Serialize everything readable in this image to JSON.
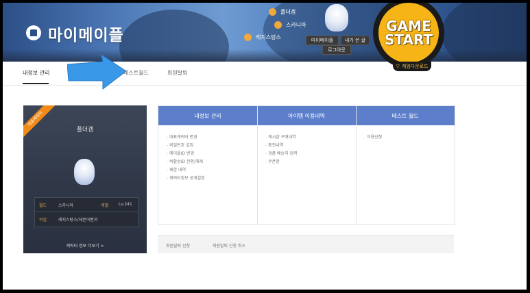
{
  "header": {
    "title": "마이메이플",
    "character_name": "플더겜",
    "world": "스카니아",
    "job": "레지스탕스",
    "buttons": [
      "마이메이플",
      "내가 쓴 글",
      "로그아웃"
    ],
    "game_start": "GAME START",
    "download": "게임다운로드"
  },
  "tabs": [
    {
      "label": "내정보 관리",
      "active": true
    },
    {
      "label": "테스트월드",
      "active": false
    },
    {
      "label": "회원탈퇴",
      "active": false
    }
  ],
  "character_card": {
    "ribbon": "대표캐릭터",
    "name": "플더겜",
    "world_label": "월드",
    "world_value": "스카니아",
    "level_label": "레벨",
    "level_value": "Lv.241",
    "job_label": "직업",
    "job_value": "레지스탕스/데몬어벤져",
    "more_link": "캐릭터 정보 더보기 >"
  },
  "menu": {
    "columns": [
      {
        "header": "내정보 관리",
        "items": [
          "대표캐릭터 변경",
          "비밀번호 설정",
          "메이플ID 변경",
          "비활성ID 전환/해제",
          "제한 내역",
          "캐릭터정보 공개설정"
        ]
      },
      {
        "header": "아이템 이용내역",
        "items": [
          "캐시샵 구매내역",
          "충전내역",
          "경품 배송지 입력",
          "쿠폰함"
        ]
      },
      {
        "header": "테스트 월드",
        "items": [
          "이용신청"
        ]
      }
    ]
  },
  "withdraw": {
    "apply": "회원탈퇴 신청",
    "cancel": "회원탈퇴 신청 취소"
  },
  "colors": {
    "menu_header": "#5d7fcb",
    "accent_orange": "#f08a18",
    "game_start": "#f6b417",
    "arrow": "#3a98e8"
  }
}
